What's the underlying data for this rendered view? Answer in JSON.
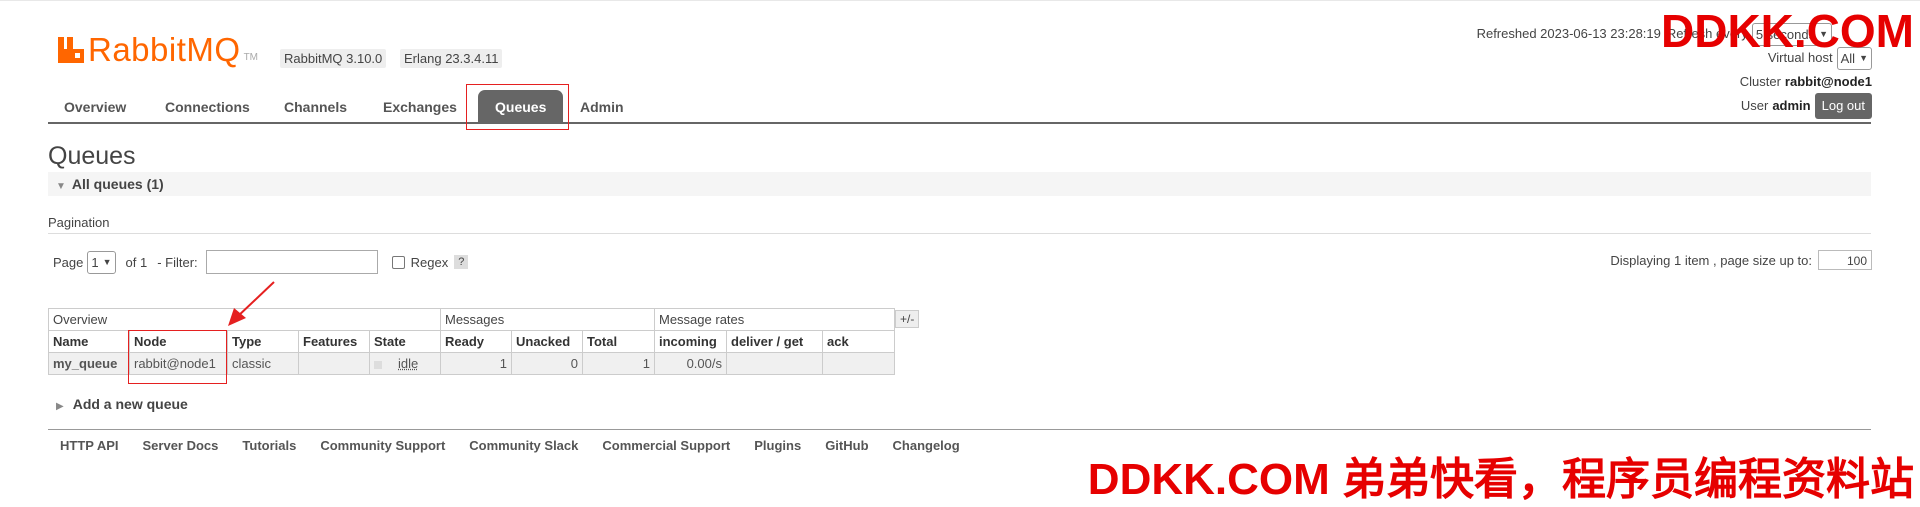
{
  "brand": {
    "name": "RabbitMQ",
    "tm": "TM"
  },
  "versions": {
    "rabbitmq": "RabbitMQ 3.10.0",
    "erlang": "Erlang 23.3.4.11"
  },
  "top_right": {
    "refreshed_label": "Refreshed 2023-06-13 23:28:19",
    "refresh_every_label": "Refresh every",
    "refresh_value": "5 seconds",
    "virtual_host_label": "Virtual host",
    "virtual_host_value": "All",
    "cluster_label": "Cluster",
    "cluster_value": "rabbit@node1",
    "user_label": "User",
    "user_value": "admin",
    "logout_label": "Log out"
  },
  "nav": {
    "tabs": [
      {
        "label": "Overview"
      },
      {
        "label": "Connections"
      },
      {
        "label": "Channels"
      },
      {
        "label": "Exchanges"
      },
      {
        "label": "Queues",
        "active": true
      },
      {
        "label": "Admin"
      }
    ]
  },
  "page": {
    "title": "Queues",
    "section_label": "All queues (1)"
  },
  "pagination": {
    "label": "Pagination",
    "page_label": "Page",
    "page_value": "1",
    "of_label": "of 1",
    "filter_label": "- Filter:",
    "filter_value": "",
    "regex_label": "Regex",
    "help_label": "?",
    "displaying_label": "Displaying 1 item , page size up to:",
    "page_size": "100"
  },
  "table": {
    "groups": [
      "Overview",
      "Messages",
      "Message rates"
    ],
    "columns": [
      "Name",
      "Node",
      "Type",
      "Features",
      "State",
      "Ready",
      "Unacked",
      "Total",
      "incoming",
      "deliver / get",
      "ack"
    ],
    "rows": [
      {
        "name": "my_queue",
        "node": "rabbit@node1",
        "type": "classic",
        "features": "",
        "state": "idle",
        "ready": "1",
        "unacked": "0",
        "total": "1",
        "incoming": "0.00/s",
        "deliver_get": "",
        "ack": ""
      }
    ],
    "plus_minus": "+/-"
  },
  "add_queue_label": "Add a new queue",
  "footer": {
    "links": [
      "HTTP API",
      "Server Docs",
      "Tutorials",
      "Community Support",
      "Community Slack",
      "Commercial Support",
      "Plugins",
      "GitHub",
      "Changelog"
    ]
  },
  "watermarks": {
    "top": "DDKK.COM",
    "bottom": "DDKK.COM 弟弟快看，程序员编程资料站"
  },
  "colors": {
    "brand": "#ff6600",
    "nav_active": "#666666",
    "annotation": "#e52020",
    "watermark": "#e60000"
  }
}
